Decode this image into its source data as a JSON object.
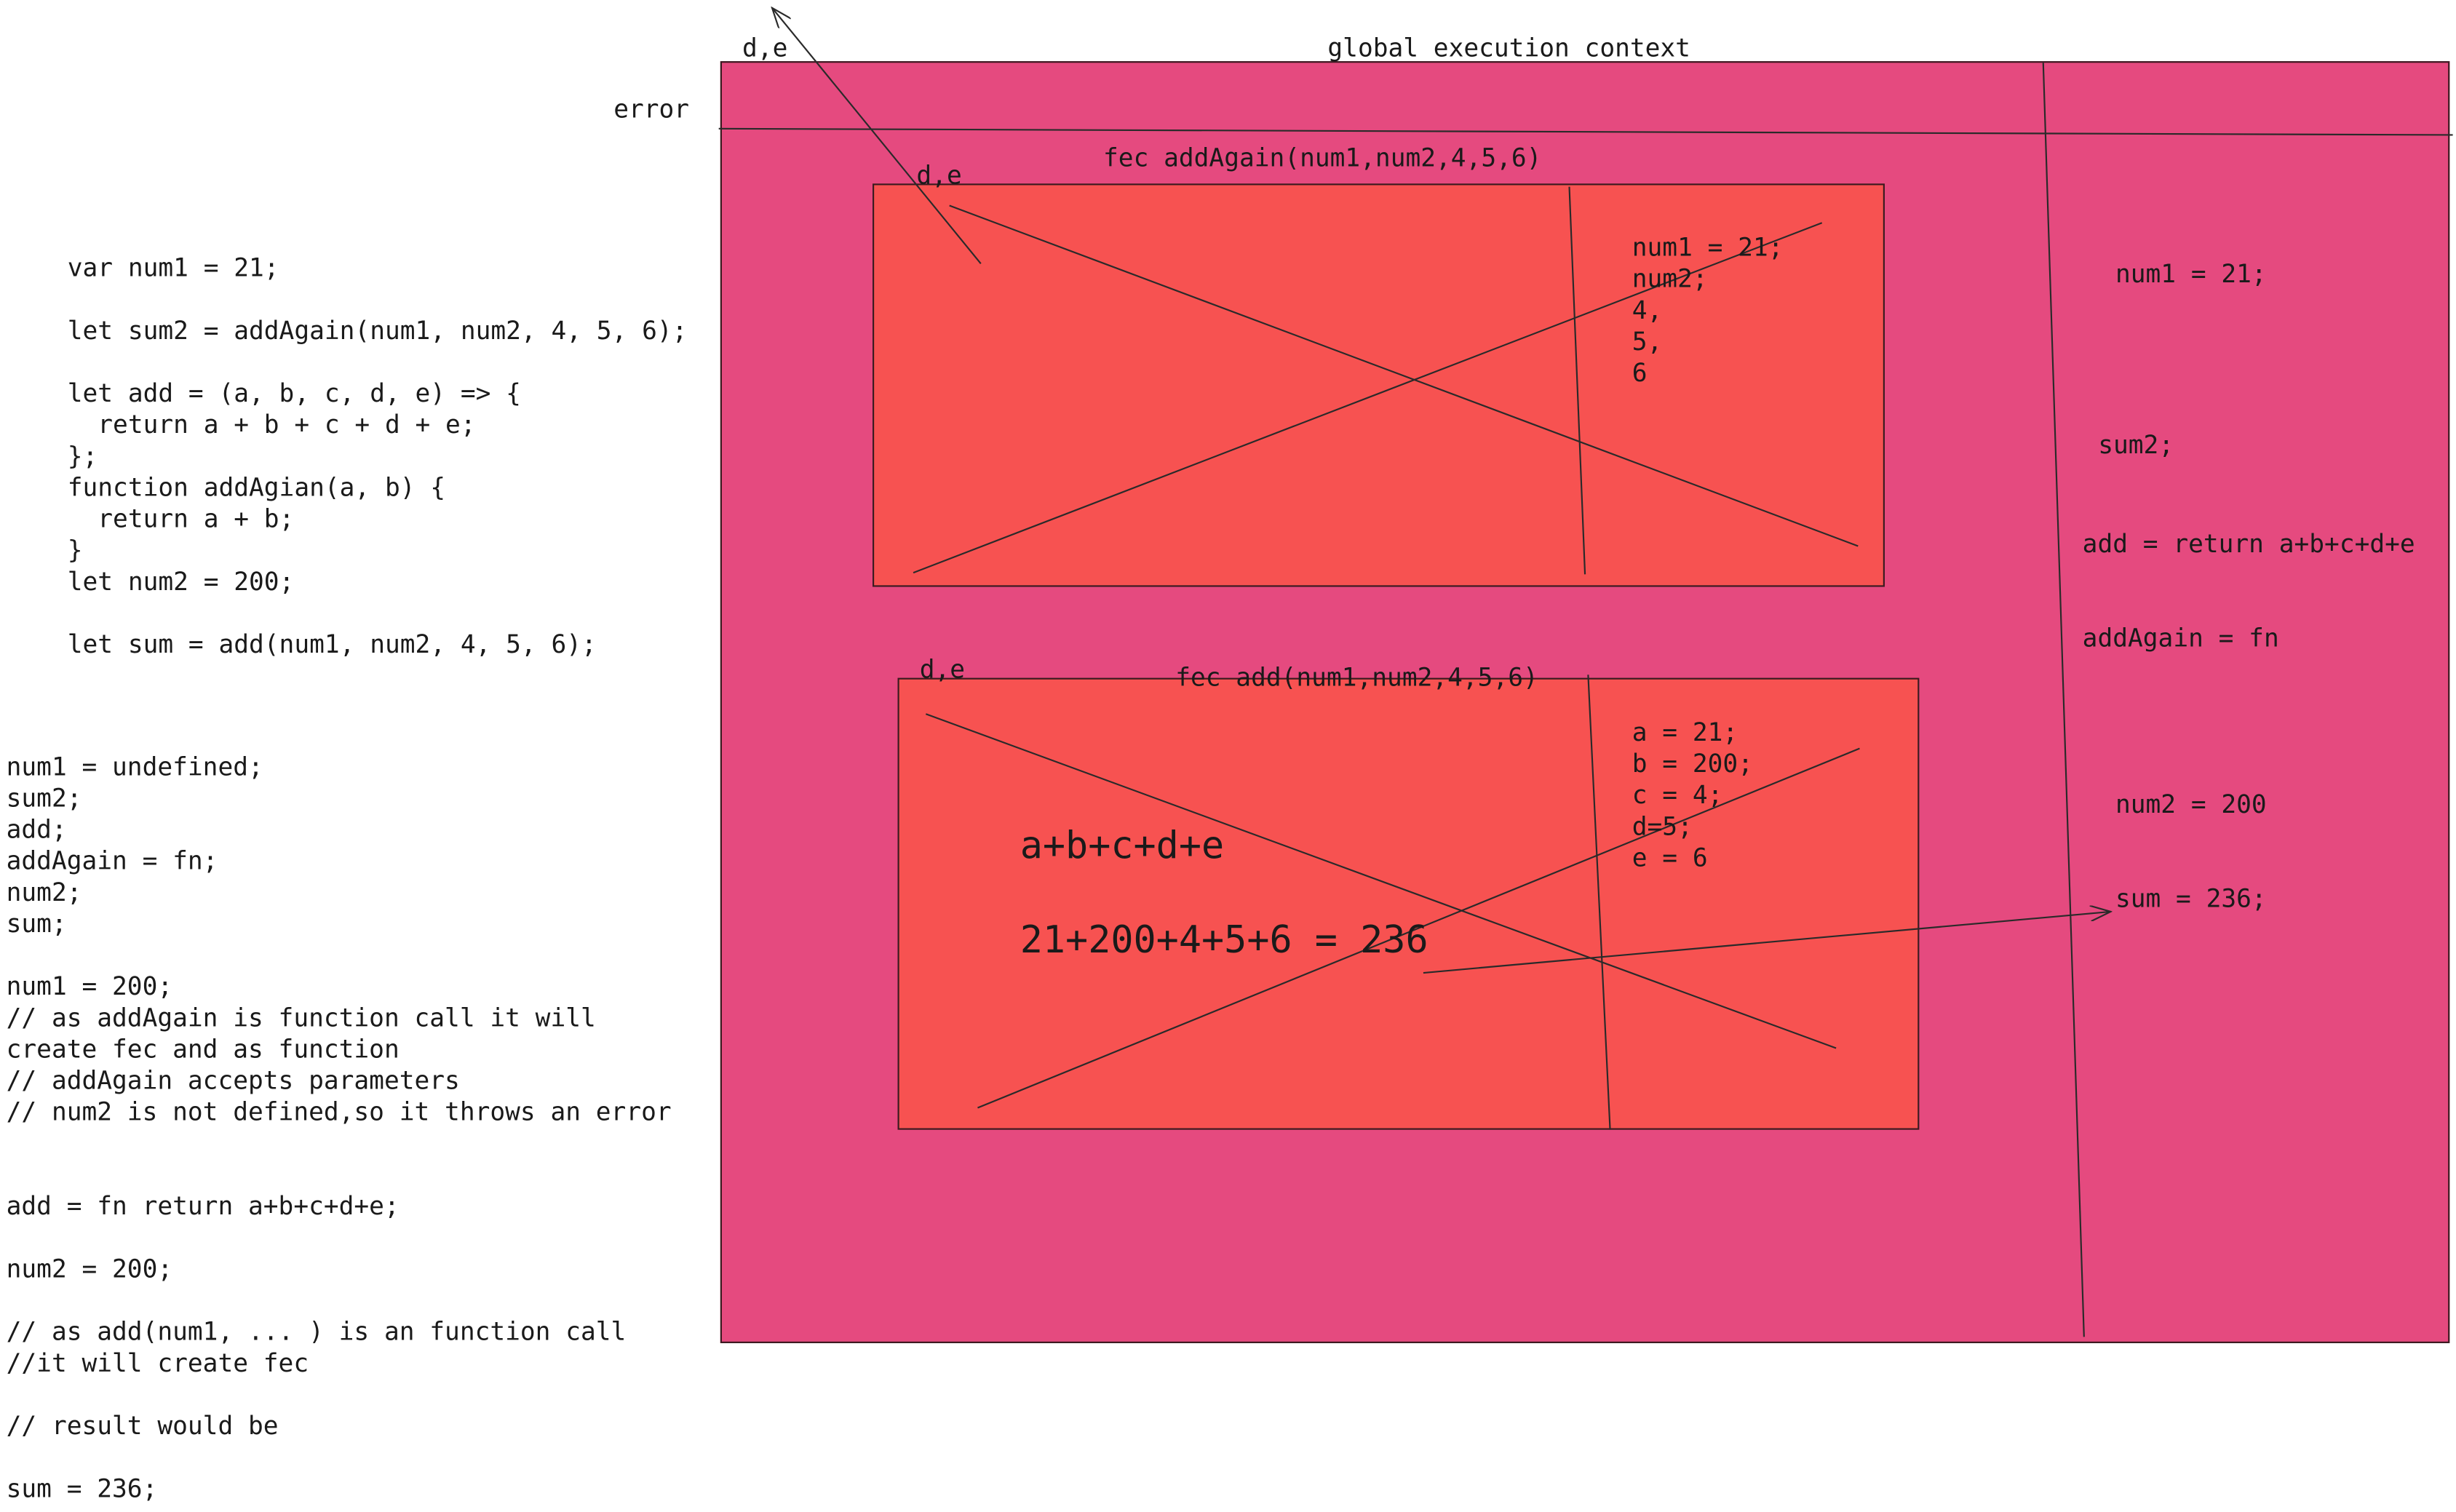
{
  "code": [
    "var num1 = 21;",
    "",
    "let sum2 = addAgain(num1, num2, 4, 5, 6);",
    "",
    "let add = (a, b, c, d, e) => {",
    "  return a + b + c + d + e;",
    "};",
    "function addAgian(a, b) {",
    "  return a + b;",
    "}",
    "let num2 = 200;",
    "",
    "let sum = add(num1, num2, 4, 5, 6);"
  ],
  "notes": [
    "num1 = undefined;",
    "sum2;",
    "add;",
    "addAgain = fn;",
    "num2;",
    "sum;",
    "",
    "num1 = 200;",
    "// as addAgain is function call it will",
    "create fec and as function",
    "// addAgain accepts parameters",
    "// num2 is not defined,so it throws an error",
    "",
    "",
    "add = fn return a+b+c+d+e;",
    "",
    "num2 = 200;",
    "",
    "// as add(num1, ... ) is an function call",
    "//it will create fec",
    "",
    "// result would be",
    "",
    "sum = 236;"
  ],
  "labels": {
    "de_top": "d,e",
    "error": "error",
    "global_title": "global execution context",
    "fec1_title": "fec addAgain(num1,num2,4,5,6)",
    "fec1_de": "d,e",
    "fec2_title": "fec add(num1,num2,4,5,6)",
    "fec2_de": "d,e"
  },
  "fec1_vars": [
    "num1 = 21;",
    "num2;",
    "4,",
    "5,",
    "6"
  ],
  "fec2_vars": [
    "a = 21;",
    "b = 200;",
    "c = 4;",
    "d=5;",
    "e = 6"
  ],
  "fec2_expr": "a+b+c+d+e",
  "fec2_result": "21+200+4+5+6 = 236",
  "global_vars": {
    "num1": "num1 = 21;",
    "sum2": "sum2;",
    "add": "add = return a+b+c+d+e",
    "addAgain": "addAgain = fn",
    "num2": "num2 = 200",
    "sum": "sum = 236;"
  },
  "colors": {
    "global_bg": "#e54a7f",
    "fec_bg": "#f75251",
    "stroke": "#2a2a2a"
  }
}
